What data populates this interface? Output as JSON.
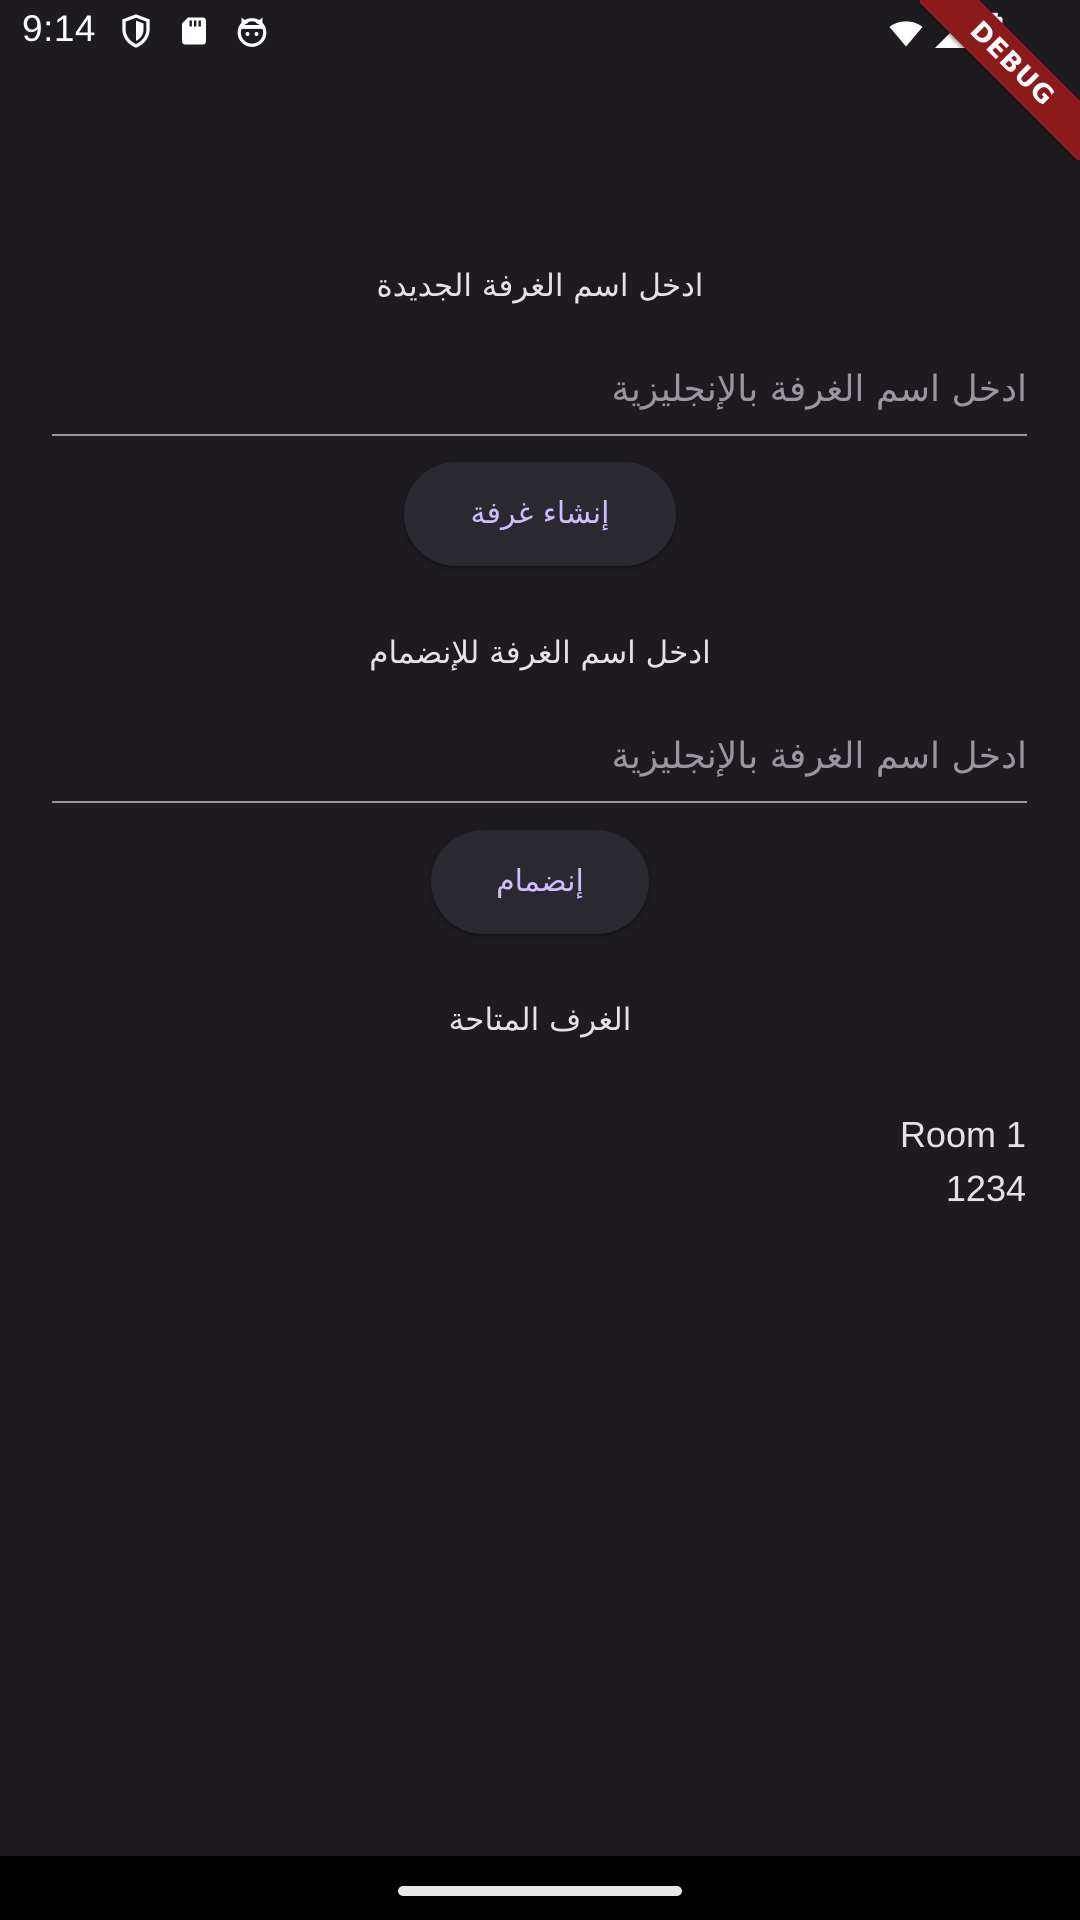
{
  "status_bar": {
    "time": "9:14",
    "left_icons": [
      "shield-icon",
      "sd-card-icon",
      "cat-face-icon"
    ],
    "right_icons": [
      "wifi-icon",
      "cell-signal-icon",
      "battery-icon"
    ]
  },
  "debug_banner": "DEBUG",
  "create_room": {
    "label": "ادخل اسم الغرفة الجديدة",
    "input_value": "",
    "placeholder": "ادخل اسم الغرفة بالإنجليزية",
    "button_label": "إنشاء غرفة"
  },
  "join_room": {
    "label": "ادخل اسم الغرفة للإنضمام",
    "input_value": "",
    "placeholder": "ادخل اسم الغرفة بالإنجليزية",
    "button_label": "إنضمام"
  },
  "available_rooms": {
    "title": "الغرف المتاحة",
    "rooms": [
      {
        "name": "Room 1",
        "code": "1234"
      }
    ]
  },
  "colors": {
    "background": "#1d1b20",
    "accent": "#d0bcff",
    "debug_banner": "#8b1a1a",
    "divider": "#9a96a0"
  }
}
